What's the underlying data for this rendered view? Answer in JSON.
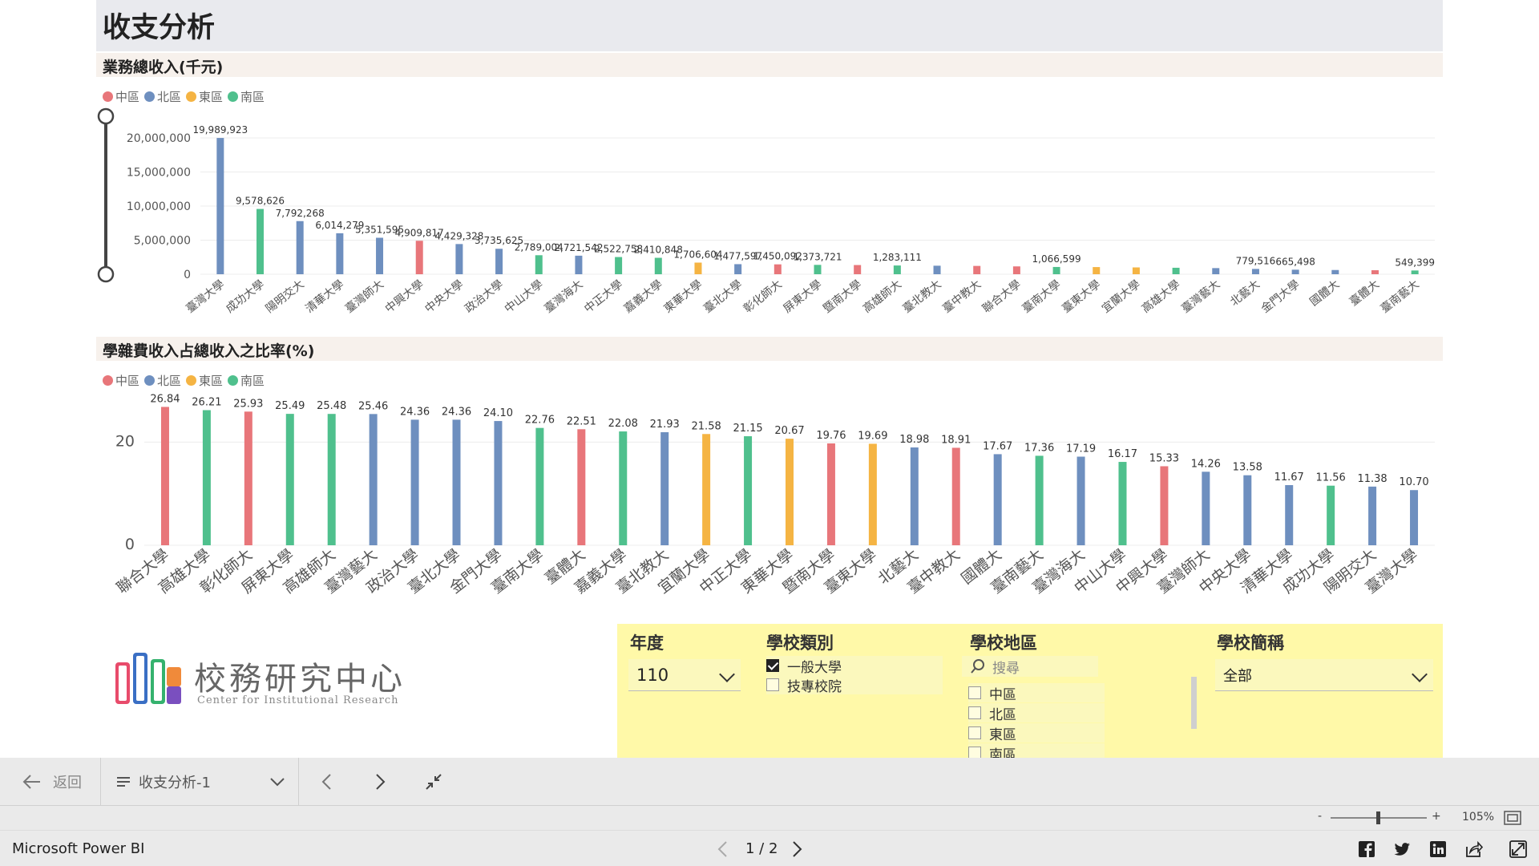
{
  "report": {
    "title": "收支分析",
    "chart1": {
      "heading": "業務總收入(千元)",
      "legend": [
        {
          "name": "中區",
          "color": "#e8767a"
        },
        {
          "name": "北區",
          "color": "#6e8fbf"
        },
        {
          "name": "東區",
          "color": "#f5b443"
        },
        {
          "name": "南區",
          "color": "#4fc08d"
        }
      ]
    },
    "chart2": {
      "heading": "學雜費收入占總收入之比率(%)",
      "legend": [
        {
          "name": "中區",
          "color": "#e8767a"
        },
        {
          "name": "北區",
          "color": "#6e8fbf"
        },
        {
          "name": "東區",
          "color": "#f5b443"
        },
        {
          "name": "南區",
          "color": "#4fc08d"
        }
      ]
    }
  },
  "chart_data": [
    {
      "type": "bar",
      "title": "業務總收入(千元)",
      "ylim": [
        0,
        20000000
      ],
      "yticks": [
        "0",
        "5,000,000",
        "10,000,000",
        "15,000,000",
        "20,000,000"
      ],
      "categories": [
        "臺灣大學",
        "成功大學",
        "陽明交大",
        "清華大學",
        "臺灣師大",
        "中興大學",
        "中央大學",
        "政治大學",
        "中山大學",
        "臺灣海大",
        "中正大學",
        "嘉義大學",
        "東華大學",
        "臺北大學",
        "彰化師大",
        "屏東大學",
        "暨南大學",
        "高雄師大",
        "臺北教大",
        "臺中教大",
        "聯合大學",
        "臺南大學",
        "臺東大學",
        "宜蘭大學",
        "高雄大學",
        "臺灣藝大",
        "北藝大",
        "金門大學",
        "國體大",
        "臺體大",
        "臺南藝大"
      ],
      "region": [
        "北區",
        "南區",
        "北區",
        "北區",
        "北區",
        "中區",
        "北區",
        "北區",
        "南區",
        "北區",
        "南區",
        "南區",
        "東區",
        "北區",
        "中區",
        "南區",
        "中區",
        "南區",
        "北區",
        "中區",
        "中區",
        "南區",
        "東區",
        "東區",
        "南區",
        "北區",
        "北區",
        "北區",
        "北區",
        "中區",
        "南區"
      ],
      "values": [
        19989923,
        9578626,
        7792268,
        6014279,
        5351595,
        4909817,
        4429328,
        3735625,
        2789004,
        2721542,
        2522758,
        2410848,
        1706604,
        1477597,
        1450092,
        1373721,
        1350000,
        1283111,
        1250000,
        1220000,
        1150000,
        1066599,
        1050000,
        1000000,
        950000,
        900000,
        779516,
        665498,
        620000,
        590000,
        549399
      ],
      "labels": [
        "19,989,923",
        "9,578,626",
        "7,792,268",
        "6,014,279",
        "5,351,595",
        "4,909,817",
        "4,429,328",
        "3,735,625",
        "2,789,004",
        "2,721,542",
        "2,522,758",
        "2,410,848",
        "1,706,604",
        "1,477,597",
        "1,450,092",
        "1,373,721",
        "",
        "1,283,111",
        "",
        "",
        "",
        "1,066,599",
        "",
        "",
        "",
        "",
        "779,516",
        "665,498",
        "",
        "",
        "549,399"
      ]
    },
    {
      "type": "bar",
      "title": "學雜費收入占總收入之比率(%)",
      "ylim": [
        0,
        28
      ],
      "yticks": [
        "0",
        "20"
      ],
      "categories": [
        "聯合大學",
        "高雄大學",
        "彰化師大",
        "屏東大學",
        "高雄師大",
        "臺灣藝大",
        "政治大學",
        "臺北大學",
        "金門大學",
        "臺南大學",
        "臺體大",
        "嘉義大學",
        "臺北教大",
        "宜蘭大學",
        "中正大學",
        "東華大學",
        "暨南大學",
        "臺東大學",
        "北藝大",
        "臺中教大",
        "國體大",
        "臺南藝大",
        "臺灣海大",
        "中山大學",
        "中興大學",
        "臺灣師大",
        "中央大學",
        "清華大學",
        "成功大學",
        "陽明交大",
        "臺灣大學"
      ],
      "region": [
        "中區",
        "南區",
        "中區",
        "南區",
        "南區",
        "北區",
        "北區",
        "北區",
        "北區",
        "南區",
        "中區",
        "南區",
        "北區",
        "東區",
        "南區",
        "東區",
        "中區",
        "東區",
        "北區",
        "中區",
        "北區",
        "南區",
        "北區",
        "南區",
        "中區",
        "北區",
        "北區",
        "北區",
        "南區",
        "北區",
        "北區"
      ],
      "values": [
        26.84,
        26.21,
        25.93,
        25.49,
        25.48,
        25.46,
        24.36,
        24.36,
        24.1,
        22.76,
        22.51,
        22.08,
        21.93,
        21.58,
        21.15,
        20.67,
        19.76,
        19.69,
        18.98,
        18.91,
        17.67,
        17.36,
        17.19,
        16.17,
        15.33,
        14.26,
        13.58,
        11.67,
        11.56,
        11.38,
        10.7
      ],
      "labels": [
        "26.84",
        "26.21",
        "25.93",
        "25.49",
        "25.48",
        "25.46",
        "24.36",
        "24.36",
        "24.10",
        "22.76",
        "22.51",
        "22.08",
        "21.93",
        "21.58",
        "21.15",
        "20.67",
        "19.76",
        "19.69",
        "18.98",
        "18.91",
        "17.67",
        "17.36",
        "17.19",
        "16.17",
        "15.33",
        "14.26",
        "13.58",
        "11.67",
        "11.56",
        "11.38",
        "10.70"
      ]
    }
  ],
  "logo": {
    "zh": "校務研究中心",
    "en": "Center for Institutional Research"
  },
  "filters": {
    "year": {
      "title": "年度",
      "value": "110"
    },
    "school_type": {
      "title": "學校類別",
      "options": [
        {
          "label": "一般大學",
          "checked": true
        },
        {
          "label": "技專校院",
          "checked": false
        }
      ]
    },
    "region": {
      "title": "學校地區",
      "search_placeholder": "搜尋",
      "options": [
        "中區",
        "北區",
        "東區",
        "南區"
      ]
    },
    "school": {
      "title": "學校簡稱",
      "value": "全部"
    }
  },
  "nav": {
    "back": "返回",
    "page_select": "收支分析-1"
  },
  "zoom": {
    "level": "105%"
  },
  "footer": {
    "brand": "Microsoft Power BI",
    "pager": "1 / 2"
  }
}
